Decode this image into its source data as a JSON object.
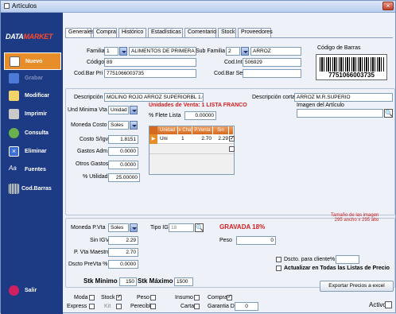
{
  "window": {
    "title": "Artículos",
    "close": "×"
  },
  "sidebar": {
    "logo_a": "DATA",
    "logo_b": "MARKET",
    "items": [
      {
        "label": "Nuevo"
      },
      {
        "label": "Grabar"
      },
      {
        "label": "Modificar"
      },
      {
        "label": "Imprimir"
      },
      {
        "label": "Consulta"
      },
      {
        "label": "Eliminar"
      },
      {
        "label": "Fuentes"
      },
      {
        "label": "Cod.Barras"
      },
      {
        "label": "Salir"
      }
    ]
  },
  "tabs": [
    "Generales",
    "Compra",
    "Histórico",
    "Estadísticas",
    "Comentario",
    "Stock",
    "Proveedores"
  ],
  "general": {
    "familia_label": "Familia",
    "familia_code": "1",
    "familia_name": "ALIMENTOS DE PRIMERA",
    "subfamilia_label": "Sub Familia",
    "subfamilia_code": "2",
    "subfamilia_name": "ARROZ",
    "codigo_label": "Código",
    "codigo": "89",
    "codint_label": "Cod.Int.",
    "codint": "506929",
    "codbarpri_label": "Cod.Bar Pri",
    "codbarpri": "7751066003735",
    "codbarsec_label": "Cod.Bar Sec",
    "codbarsec": "",
    "barcode_title": "Código de Barras",
    "barcode_number": "7751066003735"
  },
  "desc": {
    "descripcion_label": "Descripción",
    "descripcion": "MOLINO ROJO ARROZ SUPERIORBL  1.00 KG",
    "corta_label": "Descripción corta",
    "corta": "ARROZ M.R.SUPERIO",
    "unidad_label": "Und Minima Vta",
    "unidad": "Unidad",
    "moneda_label": "Moneda Costo",
    "moneda": "Soles",
    "costo_label": "Costo S/Igv",
    "costo": "1.8151",
    "gastos_label": "Gastos Adm.",
    "gastos": "0.0000",
    "otros_label": "Otros Gastos",
    "otros": "0.0000",
    "utilidad_label": "% Utilidad",
    "utilidad": "25.00000",
    "unidades_venta": "Unidades de Venta: 1 LISTA FRANCO",
    "flete_label": "% Flete Lista",
    "flete": "0.00000",
    "imagen_label": "Imagen del Artículo",
    "grid_headers": [
      "Unidad",
      "x Cha",
      "P.Venta",
      "Sin IGV",
      ""
    ],
    "grid_row": {
      "unidad": "Uni",
      "x": "1",
      "pventa": "2.70",
      "sinigv": "2.29"
    }
  },
  "bottom": {
    "tamano_note": "Tamaño de las imagen\n295 ancho x 295 alto",
    "moneda_pvta_label": "Moneda P.Vta",
    "moneda_pvta": "Soles",
    "tipo_igv_label": "Tipo IGV",
    "tipo_igv": "18",
    "gravada": "GRAVADA 18%",
    "sin_igv_label": "Sin IGV",
    "sin_igv": "2.29",
    "peso_label": "Peso",
    "peso": "0",
    "pvta_maestro_label": "P. Vta Maestro",
    "pvta_maestro": "2.70",
    "dscto_label": "Dscto PreVta %",
    "dscto": "0.0000",
    "dscto_cliente_label": "Dscto. para cliente%",
    "actualizar_label": "Actualizar en Todas las Listas de Precio",
    "stk_min_label": "Stk Minimo",
    "stk_min": "150",
    "stk_max_label": "Stk Máximo",
    "stk_max": "1500",
    "exportar_label": "Exportar Precios a excel",
    "moda": "Moda",
    "stock": "Stock",
    "peso_chk": "Peso",
    "insumo": "Insumo",
    "comprar": "Comprar",
    "express": "Express",
    "kit": "Kit",
    "perecible": "Perecible",
    "carta": "Carta",
    "garantia": "Garantia Dias",
    "garantia_val": "0",
    "activo": "Activo"
  },
  "colors": {
    "sidebar": "#1d3b84",
    "accent": "#e78e2a",
    "red": "#d02020"
  }
}
